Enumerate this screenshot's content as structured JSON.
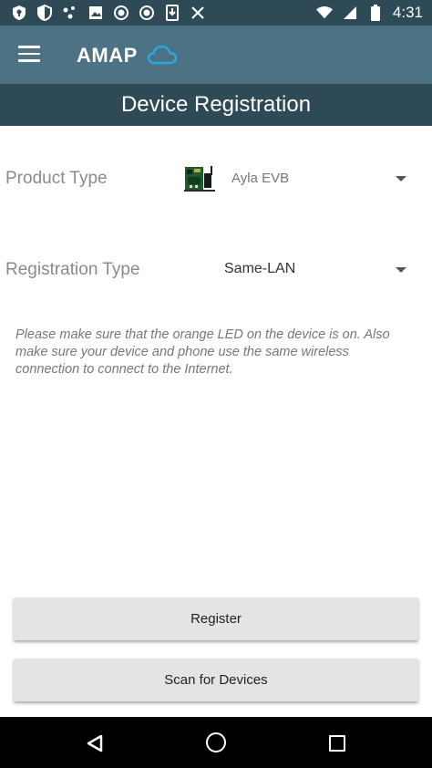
{
  "status_bar": {
    "time": "4:31",
    "icons": [
      "shield-icon",
      "shield-half-icon",
      "dots-icon",
      "image-icon",
      "record-icon",
      "record-icon",
      "download-icon",
      "cast-off-icon",
      "wifi-icon",
      "signal-icon",
      "battery-icon"
    ]
  },
  "app_bar": {
    "title": "AMAP",
    "menu_icon": "hamburger-menu-icon",
    "logo_icon": "cloud-icon",
    "accent_color": "#4c7283",
    "dark_color": "#2e4a57",
    "cloud_color": "#29a8e0"
  },
  "page": {
    "title": "Device Registration"
  },
  "product_type": {
    "label": "Product Type",
    "value": "Ayla EVB",
    "image_icon": "circuit-board-icon"
  },
  "registration_type": {
    "label": "Registration Type",
    "value": "Same-LAN"
  },
  "info_text": "Please make sure that the orange LED on the device is on. Also make sure your device and phone use the same wireless connection to connect to the Internet.",
  "buttons": {
    "register": "Register",
    "scan": "Scan for Devices"
  },
  "nav_bar": {
    "back_icon": "back-triangle-icon",
    "home_icon": "home-circle-icon",
    "recents_icon": "recents-square-icon"
  }
}
